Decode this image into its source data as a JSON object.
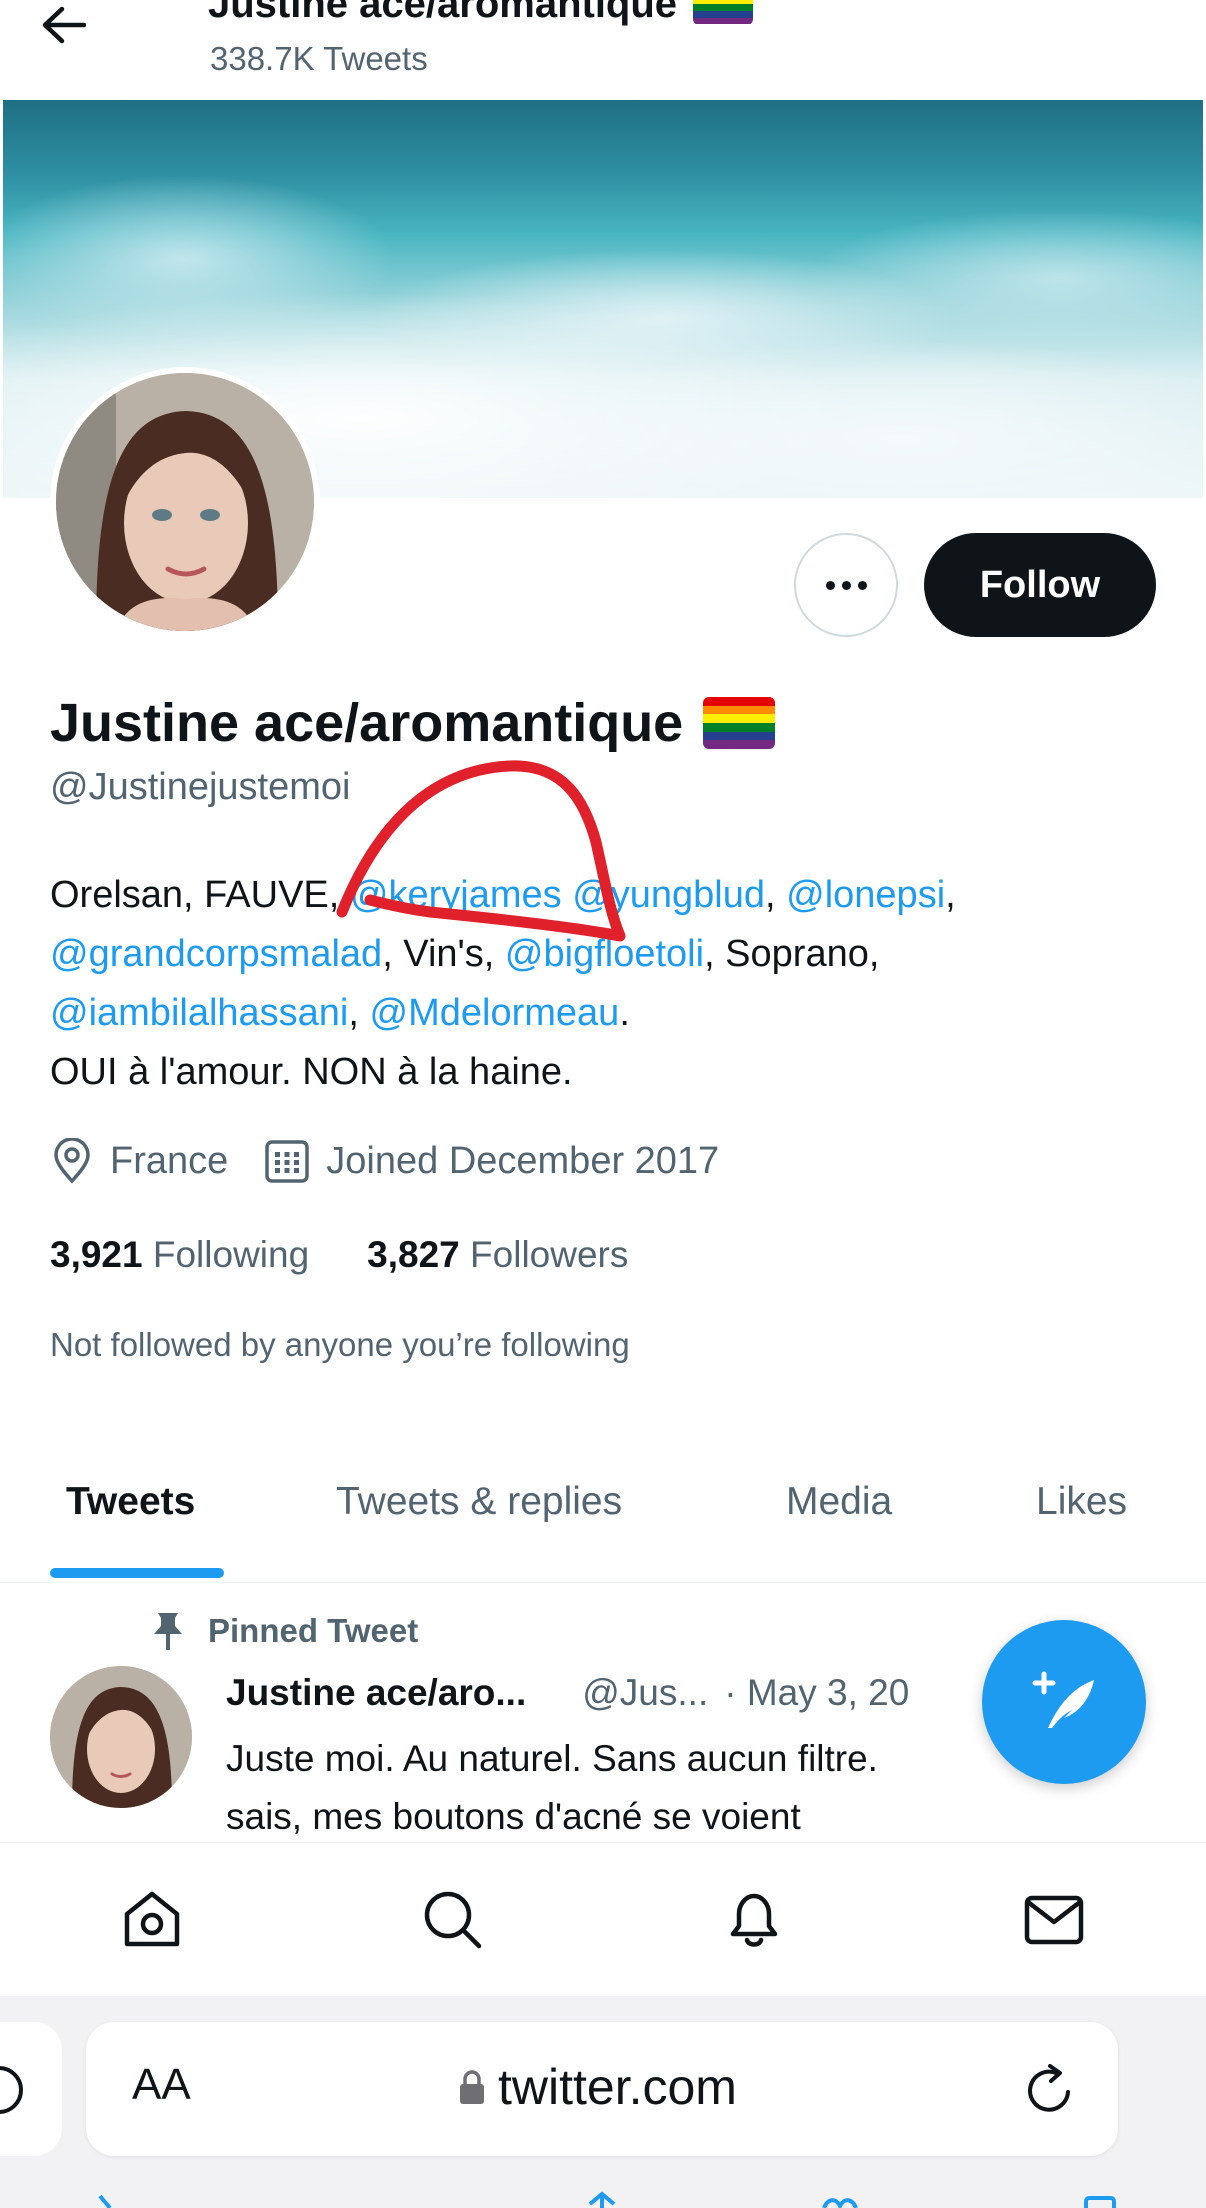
{
  "header": {
    "name": "Justine ace/aromantique",
    "tweet_count": "338.7K Tweets"
  },
  "profile": {
    "display_name": "Justine ace/aromantique",
    "handle": "@Justinejustemoi",
    "bio": {
      "line1": [
        {
          "text": "Orelsan, FAUVE, ",
          "mention": false
        },
        {
          "text": "@keryjames",
          "mention": true
        },
        {
          "text": " ",
          "mention": false
        },
        {
          "text": "@yungblud",
          "mention": true
        },
        {
          "text": ", ",
          "mention": false
        },
        {
          "text": "@lonepsi",
          "mention": true
        },
        {
          "text": ",",
          "mention": false
        }
      ],
      "line2": [
        {
          "text": "@grandcorpsmalad",
          "mention": true
        },
        {
          "text": ", Vin's, ",
          "mention": false
        },
        {
          "text": "@bigfloetoli",
          "mention": true
        },
        {
          "text": ", Soprano,",
          "mention": false
        }
      ],
      "line3": [
        {
          "text": "@iambilalhassani",
          "mention": true
        },
        {
          "text": ", ",
          "mention": false
        },
        {
          "text": "@Mdelormeau",
          "mention": true
        },
        {
          "text": ".",
          "mention": false
        }
      ],
      "line4": "OUI à l'amour. NON à la haine."
    },
    "location": "France",
    "joined": "Joined December 2017",
    "following_count": "3,921",
    "following_label": "Following",
    "followers_count": "3,827",
    "followers_label": "Followers",
    "not_followed": "Not followed by anyone you’re following"
  },
  "actions": {
    "follow_label": "Follow"
  },
  "tabs": [
    {
      "label": "Tweets",
      "active": true
    },
    {
      "label": "Tweets & replies",
      "active": false
    },
    {
      "label": "Media",
      "active": false
    },
    {
      "label": "Likes",
      "active": false
    }
  ],
  "pinned_tweet": {
    "pinned_label": "Pinned Tweet",
    "author_name": "Justine ace/aro...",
    "author_handle": "@Jus...",
    "date": "· May 3, 20",
    "text_line1": "Juste moi. Au naturel. Sans aucun filtre.",
    "text_line2": "sais, mes boutons d'acné se voient"
  },
  "bottom_nav": [
    "home-icon",
    "search-icon",
    "bell-icon",
    "mail-icon"
  ],
  "browser": {
    "text_size_label": "AA",
    "url": "twitter.com"
  },
  "colors": {
    "accent": "#1d9bf0",
    "text": "#0f1419",
    "secondary": "#536471",
    "annotation": "#e0202a"
  }
}
